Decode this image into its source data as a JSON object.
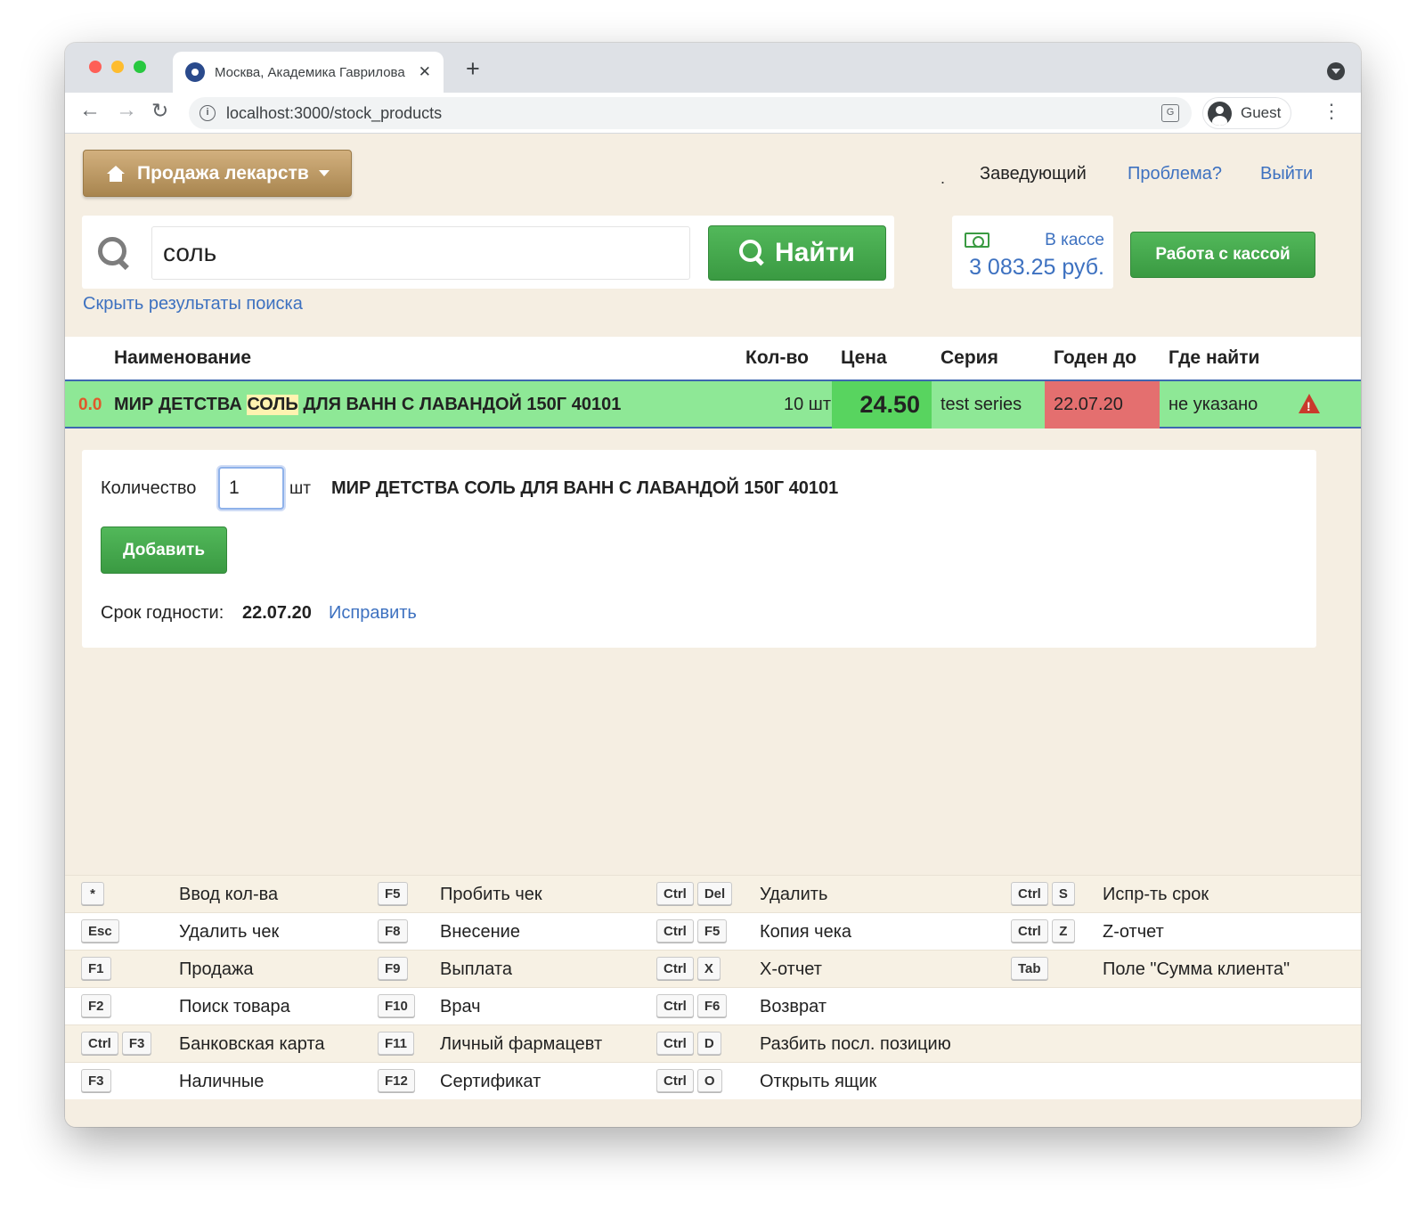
{
  "browser": {
    "tab_title": "Москва, Академика Гаврилова",
    "tab_close": "✕",
    "new_tab": "+",
    "url": "localhost:3000/stock_products",
    "profile_name": "Guest",
    "icons": [
      "back-arrow-icon",
      "forward-arrow-icon",
      "reload-icon",
      "info-icon",
      "translate-icon",
      "avatar",
      "kebab-menu-icon"
    ]
  },
  "header": {
    "app_menu_label": "Продажа лекарств",
    "user_dot": ".",
    "user_role": "Заведующий",
    "problem_link": "Проблема?",
    "logout_link": "Выйти"
  },
  "search": {
    "value": "соль",
    "button_label": "Найти",
    "hide_results_link": "Скрыть результаты поиска"
  },
  "cash": {
    "label": "В кассе",
    "amount": "3 083.25 руб.",
    "button_label": "Работа с кассой"
  },
  "results": {
    "columns": {
      "name": "Наименование",
      "qty": "Кол-во",
      "price": "Цена",
      "series": "Серия",
      "expires": "Годен до",
      "where": "Где найти"
    },
    "rows": [
      {
        "score": "0.0",
        "name_before": "МИР ДЕТСТВА ",
        "name_match": "СОЛЬ",
        "name_after": " ДЛЯ ВАНН С ЛАВАНДОЙ 150Г 40101",
        "qty": "10 шт",
        "price": "24.50",
        "series": "test series",
        "expires": "22.07.20",
        "where": "не указано"
      }
    ]
  },
  "detail": {
    "qty_label": "Количество",
    "qty_value": "1",
    "qty_unit": "шт",
    "product_name": "МИР ДЕТСТВА СОЛЬ ДЛЯ ВАНН С ЛАВАНДОЙ 150Г 40101",
    "add_button": "Добавить",
    "expiry_label": "Срок годности:",
    "expiry_value": "22.07.20",
    "fix_link": "Исправить"
  },
  "shortcuts": [
    [
      {
        "keys": [
          "*"
        ],
        "label": "Ввод кол-ва"
      },
      {
        "keys": [
          "F5"
        ],
        "label": "Пробить чек"
      },
      {
        "keys": [
          "Ctrl",
          "Del"
        ],
        "label": "Удалить"
      },
      {
        "keys": [
          "Ctrl",
          "S"
        ],
        "label": "Испр-ть срок"
      }
    ],
    [
      {
        "keys": [
          "Esc"
        ],
        "label": "Удалить чек"
      },
      {
        "keys": [
          "F8"
        ],
        "label": "Внесение"
      },
      {
        "keys": [
          "Ctrl",
          "F5"
        ],
        "label": "Копия чека"
      },
      {
        "keys": [
          "Ctrl",
          "Z"
        ],
        "label": "Z-отчет"
      }
    ],
    [
      {
        "keys": [
          "F1"
        ],
        "label": "Продажа"
      },
      {
        "keys": [
          "F9"
        ],
        "label": "Выплата"
      },
      {
        "keys": [
          "Ctrl",
          "X"
        ],
        "label": "X-отчет"
      },
      {
        "keys": [
          "Tab"
        ],
        "label": "Поле \"Сумма клиента\""
      }
    ],
    [
      {
        "keys": [
          "F2"
        ],
        "label": "Поиск товара"
      },
      {
        "keys": [
          "F10"
        ],
        "label": "Врач"
      },
      {
        "keys": [
          "Ctrl",
          "F6"
        ],
        "label": "Возврат"
      }
    ],
    [
      {
        "keys": [
          "Ctrl",
          "F3"
        ],
        "label": "Банковская карта"
      },
      {
        "keys": [
          "F11"
        ],
        "label": "Личный фармацевт"
      },
      {
        "keys": [
          "Ctrl",
          "D"
        ],
        "label": "Разбить посл. позицию"
      }
    ],
    [
      {
        "keys": [
          "F3"
        ],
        "label": "Наличные"
      },
      {
        "keys": [
          "F12"
        ],
        "label": "Сертификат"
      },
      {
        "keys": [
          "Ctrl",
          "O"
        ],
        "label": "Открыть ящик"
      }
    ]
  ]
}
